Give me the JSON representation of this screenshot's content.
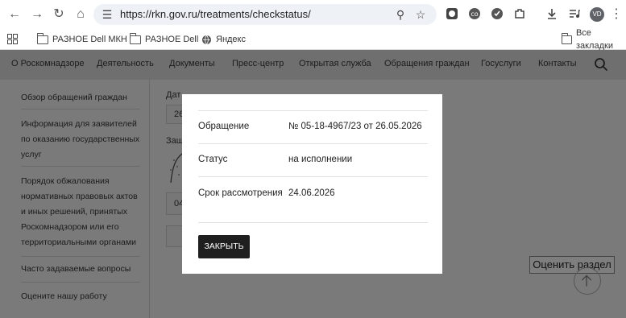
{
  "browser": {
    "url": "https://rkn.gov.ru/treatments/checkstatus/",
    "avatar": "VD",
    "bookmarks": [
      "РАЗНОЕ Dell МКН",
      "РАЗНОЕ Dell",
      "Яндекс"
    ],
    "all_bookmarks": "Все закладки"
  },
  "nav": {
    "items": [
      "О Роскомнадзоре",
      "Деятельность",
      "Документы",
      "Пресс-центр",
      "Открытая служба",
      "Обращения граждан",
      "Госуслуги",
      "Контакты"
    ]
  },
  "sidebar": {
    "items": [
      "Обзор обращений граждан",
      "Информация для заявителей по оказанию государственных услуг",
      "Порядок обжалования нормативных правовых актов и иных решений, принятых Роскомнадзором или его территориальными органами",
      "Часто задаваемые вопросы",
      "Оцените нашу работу"
    ]
  },
  "form_fragments": {
    "date_label": "Дат",
    "date_value": "26",
    "protect_label": "Защ",
    "code_value": "04"
  },
  "rate_button": "Оценить раздел",
  "modal": {
    "rows": [
      {
        "label": "Обращение",
        "value": "№ 05-18-4967/23 от 26.05.2026"
      },
      {
        "label": "Статус",
        "value": "на исполнении"
      },
      {
        "label": "Срок рассмотрения",
        "value": "24.06.2026"
      }
    ],
    "close_label": "ЗАКРЫТЬ"
  }
}
